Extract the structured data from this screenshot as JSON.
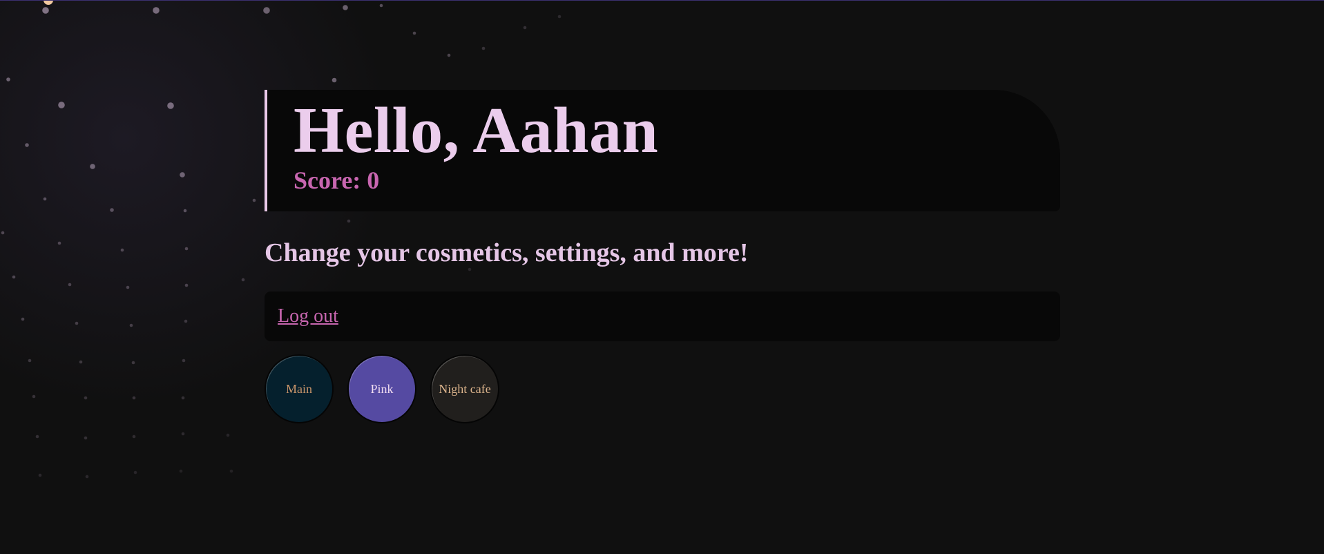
{
  "header": {
    "greeting": "Hello, Aahan",
    "score": "Score: 0"
  },
  "tagline": "Change your cosmetics, settings, and more!",
  "actions": {
    "logout_label": "Log out"
  },
  "themes": [
    {
      "label": "Main",
      "background": "#05202d",
      "text_color": "#c9956a"
    },
    {
      "label": "Pink",
      "background": "#554aa2",
      "text_color": "#f0dcf0"
    },
    {
      "label": "Night cafe",
      "background": "#211f1d",
      "text_color": "#dcb48c"
    }
  ],
  "colors": {
    "page_background": "#101010",
    "panel_background": "#080808",
    "heading": "#ebcdec",
    "accent": "#c866b0",
    "hero_border": "#e9c8e8"
  }
}
